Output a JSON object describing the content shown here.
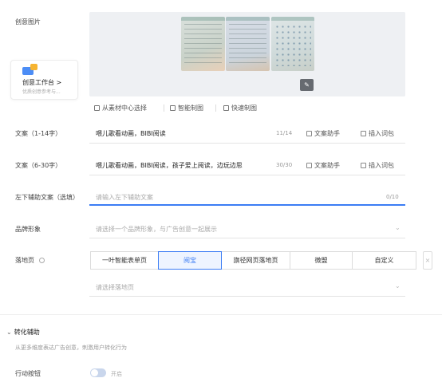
{
  "creative_image": {
    "label": "创意图片",
    "card": {
      "title": "创意工作台 >",
      "subtitle": "优质创意参考与..."
    },
    "actions": [
      {
        "label": "从素材中心选择"
      },
      {
        "label": "智能制图"
      },
      {
        "label": "快速制图"
      }
    ]
  },
  "copy_short": {
    "label": "文案（1-14字）",
    "value": "喂儿歌看动画，BIBI阅读",
    "counter": "11/14",
    "assist": "文案助手",
    "insert": "插入词包"
  },
  "copy_long": {
    "label": "文案（6-30字）",
    "value": "喂儿歌看动画，BIBI阅读，孩子爱上阅读，边玩边思",
    "counter": "30/30",
    "assist": "文案助手",
    "insert": "插入词包"
  },
  "aux_copy": {
    "label": "左下辅助文案（选填）",
    "placeholder": "请输入左下辅助文案",
    "counter": "0/10"
  },
  "brand": {
    "label": "品牌形象",
    "placeholder": "请选择一个品牌形象，与广告创意一起展示"
  },
  "landing": {
    "label": "落地页",
    "options": [
      "一叶智能表单页",
      "阅宝",
      "旗径网页落地页",
      "微盟",
      "自定义"
    ],
    "selected": "阅宝",
    "select_placeholder": "请选择落地页"
  },
  "conversion": {
    "title": "转化辅助",
    "desc": "从更多维度表达广告创意，刺激用户转化行为"
  },
  "action_button": {
    "label": "行动按钮",
    "toggle_text": "开启"
  },
  "colors": {
    "accent": "#3b7cf4",
    "toggle_bg": "#c9d6ec"
  }
}
